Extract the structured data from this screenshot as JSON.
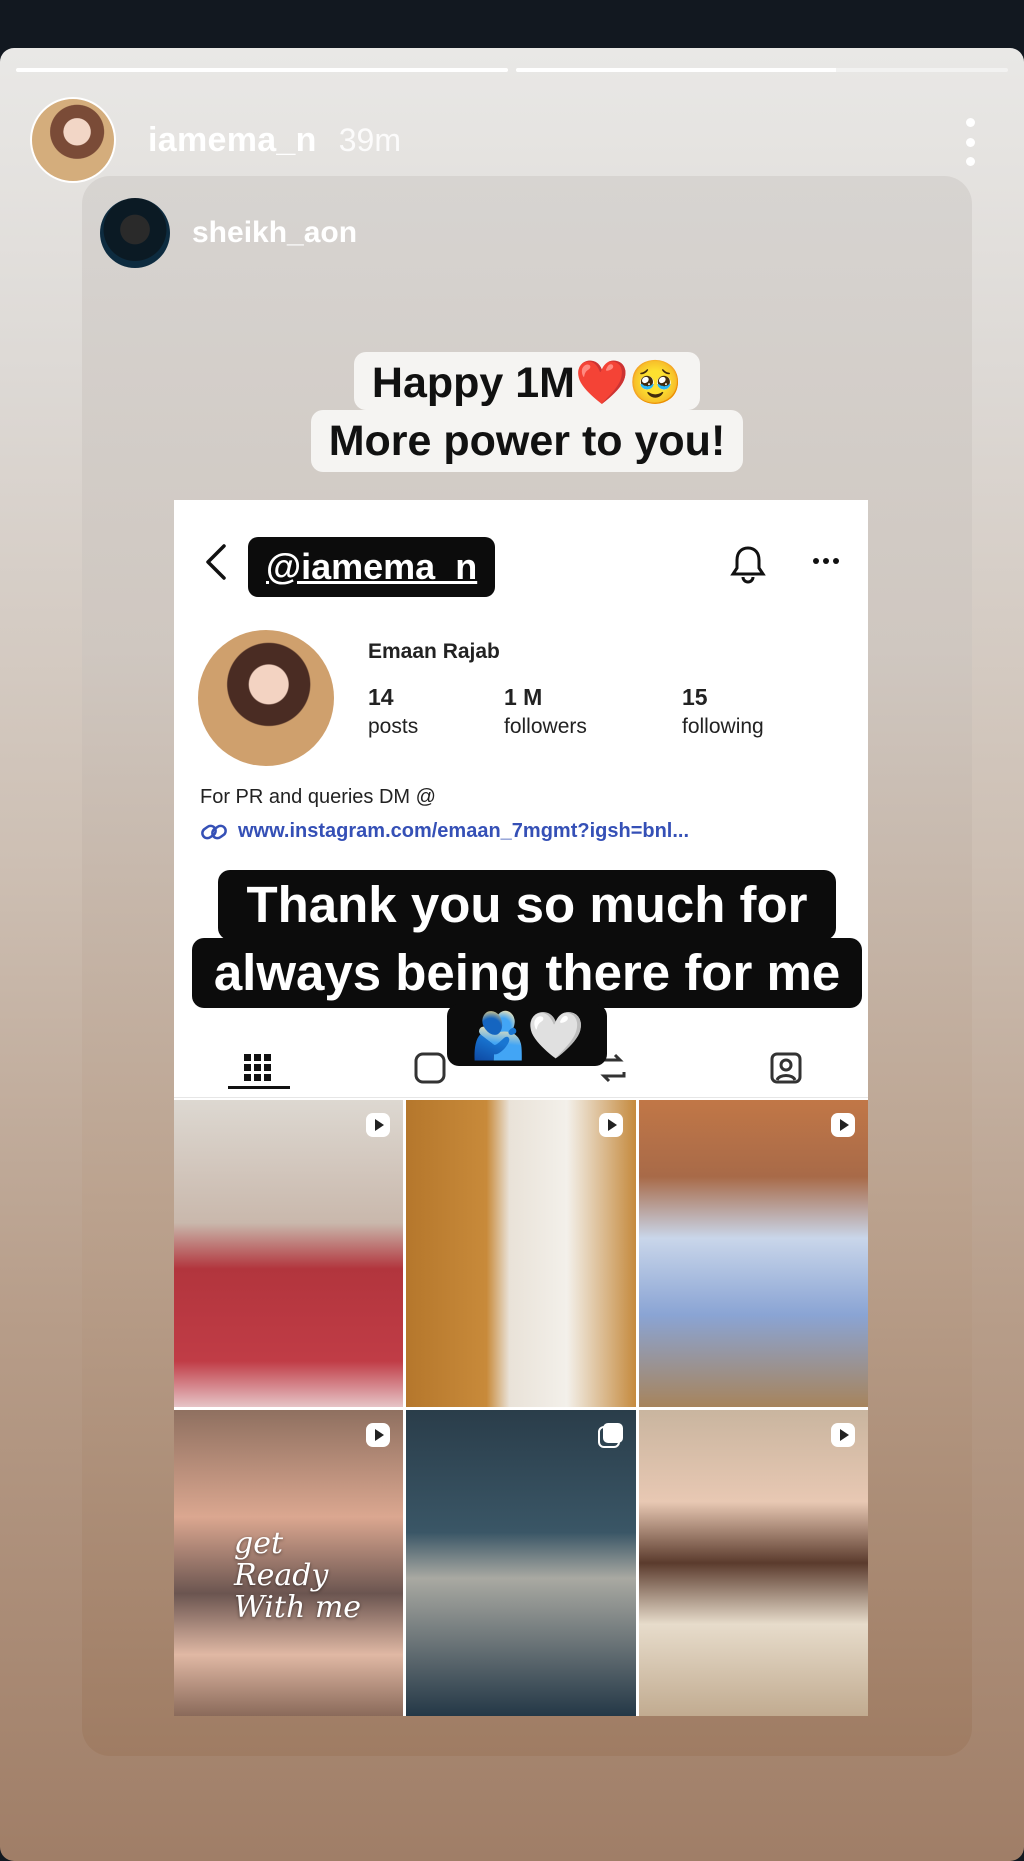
{
  "story": {
    "progress": [
      1.0,
      0.65
    ],
    "username": "iamema_n",
    "time": "39m"
  },
  "shared_post": {
    "username": "sheikh_aon",
    "caption_line1": "Happy 1M",
    "caption_line1_emojis": "❤️🥹",
    "caption_line2": "More power to you!"
  },
  "profile": {
    "handle": "@iamema_n",
    "name": "Emaan Rajab",
    "stats": [
      {
        "num": "14",
        "label": "posts"
      },
      {
        "num": "1 M",
        "label": "followers"
      },
      {
        "num": "15",
        "label": "following"
      }
    ],
    "bio": "For PR and queries DM @",
    "link": "www.instagram.com/emaan_7mgmt?igsh=bnl..."
  },
  "overlay": {
    "line1": "Thank you so much for",
    "line2": "always being there for me",
    "emojis": "🫂🤍"
  },
  "grid": {
    "ready_text_1": "get",
    "ready_text_2": "Ready",
    "ready_text_3": "With me"
  },
  "colors": {
    "link": "#3550b6",
    "caption_bg": "#0c0c0c"
  }
}
